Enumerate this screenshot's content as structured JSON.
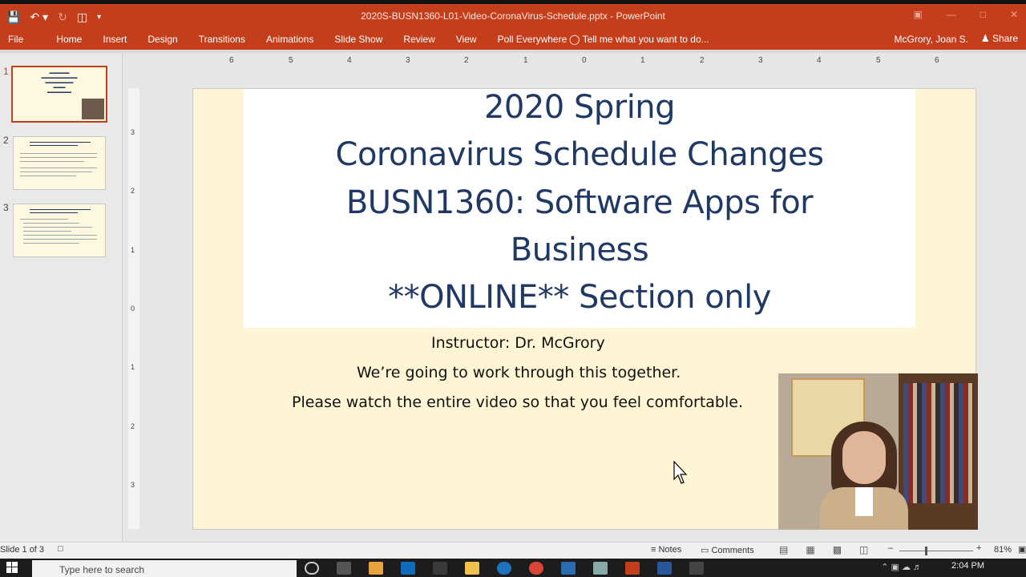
{
  "window": {
    "title": "2020S-BUSN1360-L01-Video-CoronaVirus-Schedule.pptx - PowerPoint",
    "user": "McGrory, Joan S.",
    "share_label": "Share"
  },
  "ribbon": {
    "tabs": [
      "File",
      "Home",
      "Insert",
      "Design",
      "Transitions",
      "Animations",
      "Slide Show",
      "Review",
      "View",
      "Poll Everywhere"
    ],
    "tell_me": "Tell me what you want to do..."
  },
  "thumbnails": [
    {
      "number": "1",
      "selected": true
    },
    {
      "number": "2",
      "selected": false
    },
    {
      "number": "3",
      "selected": false
    }
  ],
  "rulers": {
    "horizontal_ticks": [
      "6",
      "5",
      "4",
      "3",
      "2",
      "1",
      "0",
      "1",
      "2",
      "3",
      "4",
      "5",
      "6"
    ],
    "vertical_ticks": [
      "3",
      "2",
      "1",
      "0",
      "1",
      "2",
      "3"
    ]
  },
  "slide": {
    "title_lines": [
      "2020 Spring",
      "Coronavirus Schedule Changes",
      "BUSN1360: Software Apps for",
      "Business",
      "**ONLINE** Section only"
    ],
    "body_lines": [
      "Instructor:  Dr. McGrory",
      "We’re going to work through this together.",
      "Please watch the entire video so that you feel comfortable."
    ]
  },
  "statusbar": {
    "slide_info": "Slide 1 of 3",
    "notes_label": "Notes",
    "comments_label": "Comments",
    "zoom": "81%"
  },
  "taskbar": {
    "search_placeholder": "Type here to search",
    "time": "2:04 PM"
  },
  "colors": {
    "accent": "#c43e1c",
    "title_text": "#1f3864",
    "slide_bg": "#fff4d4"
  }
}
